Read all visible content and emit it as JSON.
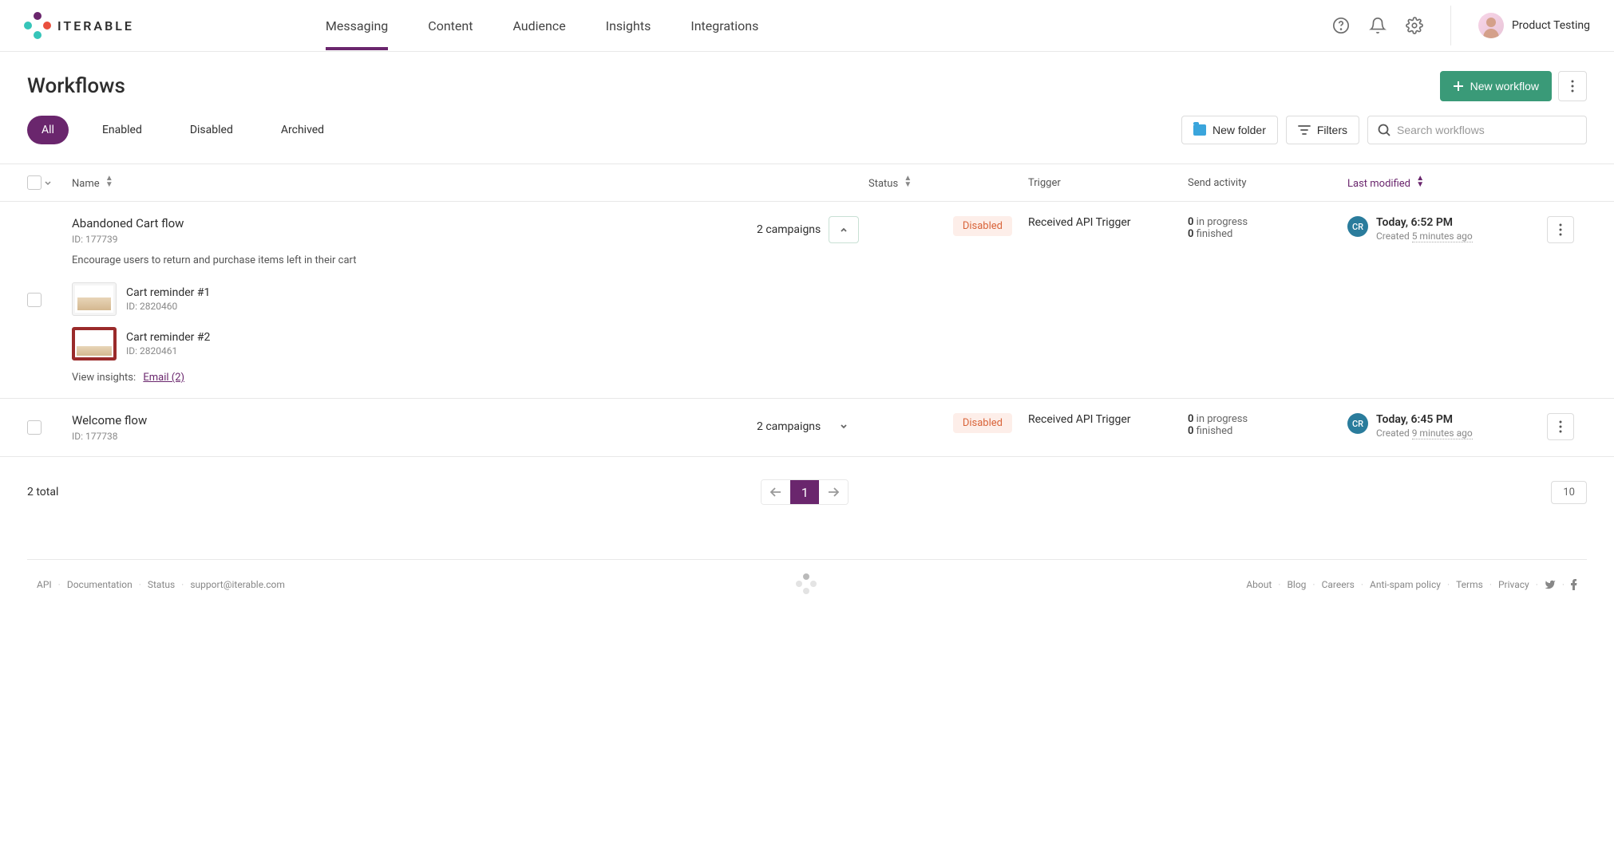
{
  "brand": "ITERABLE",
  "nav": {
    "items": [
      "Messaging",
      "Content",
      "Audience",
      "Insights",
      "Integrations"
    ],
    "active_index": 0
  },
  "user": {
    "name": "Product Testing",
    "initials": "CR"
  },
  "page": {
    "title": "Workflows",
    "new_workflow_label": "New workflow"
  },
  "tabs": {
    "items": [
      "All",
      "Enabled",
      "Disabled",
      "Archived"
    ],
    "active_index": 0
  },
  "toolbar": {
    "new_folder_label": "New folder",
    "filters_label": "Filters",
    "search_placeholder": "Search workflows"
  },
  "columns": {
    "name": "Name",
    "status": "Status",
    "trigger": "Trigger",
    "activity": "Send activity",
    "modified": "Last modified"
  },
  "rows": [
    {
      "name": "Abandoned Cart flow",
      "id": "ID: 177739",
      "description": "Encourage users to return and purchase items left in their cart",
      "campaign_count": "2 campaigns",
      "expanded": true,
      "status": "Disabled",
      "trigger": "Received API Trigger",
      "activity": {
        "progress": "0",
        "progress_label": "in progress",
        "finished": "0",
        "finished_label": "finished"
      },
      "modified": {
        "user": "CR",
        "time": "Today, 6:52 PM",
        "created_prefix": "Created ",
        "created_ago": "5 minutes ago"
      },
      "campaigns": [
        {
          "name": "Cart reminder #1",
          "id": "ID: 2820460",
          "thumb_variant": "light"
        },
        {
          "name": "Cart reminder #2",
          "id": "ID: 2820461",
          "thumb_variant": "red"
        }
      ],
      "insights_label": "View insights:",
      "insights_link": "Email (2)"
    },
    {
      "name": "Welcome flow",
      "id": "ID: 177738",
      "campaign_count": "2 campaigns",
      "expanded": false,
      "status": "Disabled",
      "trigger": "Received API Trigger",
      "activity": {
        "progress": "0",
        "progress_label": "in progress",
        "finished": "0",
        "finished_label": "finished"
      },
      "modified": {
        "user": "CR",
        "time": "Today, 6:45 PM",
        "created_prefix": "Created ",
        "created_ago": "9 minutes ago"
      }
    }
  ],
  "pagination": {
    "total": "2 total",
    "page": "1",
    "page_size": "10"
  },
  "footer": {
    "left": [
      "API",
      "Documentation",
      "Status",
      "support@iterable.com"
    ],
    "right": [
      "About",
      "Blog",
      "Careers",
      "Anti-spam policy",
      "Terms",
      "Privacy"
    ]
  }
}
